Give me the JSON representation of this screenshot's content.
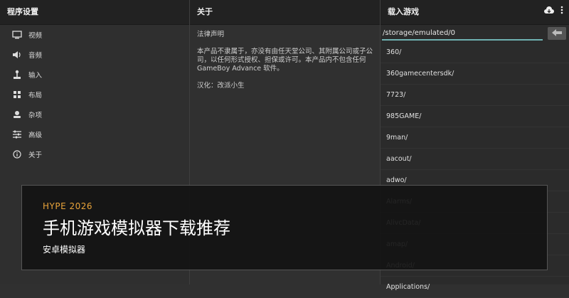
{
  "left": {
    "title": "程序设置",
    "items": [
      {
        "label": "视频",
        "icon": "monitor-icon"
      },
      {
        "label": "音频",
        "icon": "speaker-icon"
      },
      {
        "label": "输入",
        "icon": "joystick-icon"
      },
      {
        "label": "布局",
        "icon": "grid-icon"
      },
      {
        "label": "杂项",
        "icon": "person-icon"
      },
      {
        "label": "高级",
        "icon": "sliders-icon"
      },
      {
        "label": "关于",
        "icon": "info-icon"
      }
    ]
  },
  "middle": {
    "title": "关于",
    "legal_heading": "法律声明",
    "legal_text": "本产品不隶属于，亦没有由任天堂公司、其附属公司或子公司，以任何形式授权、担保或许可。本产品内不包含任何 GameBoy Advance 软件。",
    "credit": "汉化：改派小生"
  },
  "right": {
    "title": "载入游戏",
    "path": "/storage/emulated/0",
    "files": [
      "360/",
      "360gamecentersdk/",
      "7723/",
      "985GAME/",
      "9man/",
      "aacout/",
      "adwo/",
      "Alarms/",
      "AlivcData/",
      "amap/",
      "Android/",
      "Applications/"
    ]
  },
  "overlay": {
    "tag": "HYPE 2026",
    "title": "手机游戏模拟器下载推荐",
    "subtitle": "安卓模拟器"
  },
  "colors": {
    "accent_underline": "#6fb2b2",
    "overlay_tag": "#e8a33a"
  }
}
